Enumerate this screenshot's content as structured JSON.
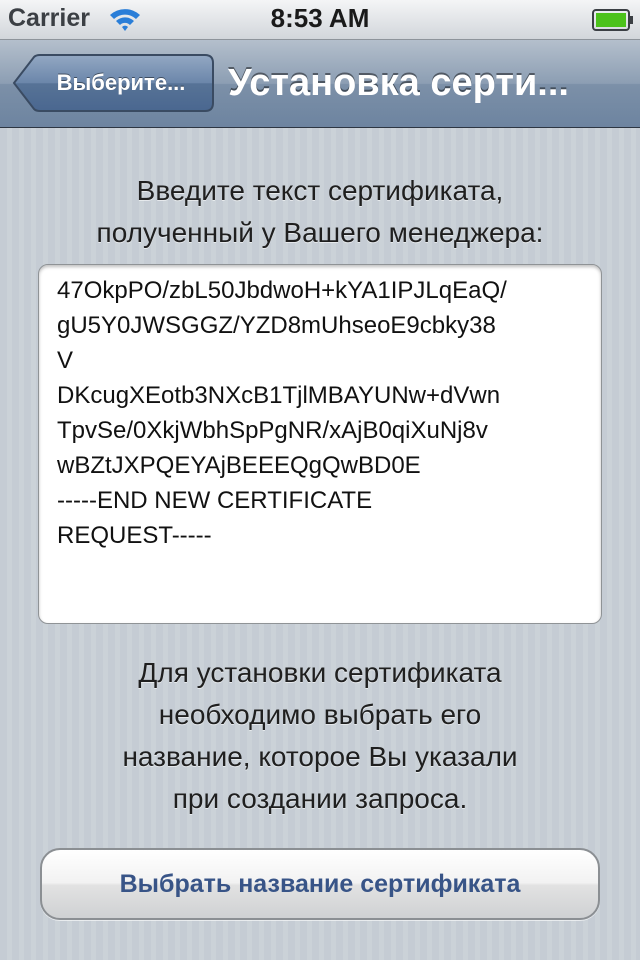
{
  "status_bar": {
    "carrier": "Carrier",
    "time": "8:53 AM",
    "wifi_icon": "wifi-icon",
    "battery_icon": "battery-full-icon",
    "battery_color": "#4cc21b"
  },
  "nav_bar": {
    "back_label": "Выберите...",
    "title": "Установка серти..."
  },
  "content": {
    "intro_lines": [
      "Введите текст сертификата,",
      "полученный у Вашего менеджера:"
    ],
    "certificate_lines": [
      "47OkpPO/zbL50JbdwoH+kYA1IPJLqEaQ/",
      "gU5Y0JWSGGZ/YZD8mUhseoE9cbky38",
      "V",
      "DKcugXEotb3NXcB1TjlMBAYUNw+dVwn",
      "TpvSe/0XkjWbhSpPgNR/xAjB0qiXuNj8v",
      "wBZtJXPQEYAjBEEEQgQwBD0E",
      "-----END NEW CERTIFICATE",
      "REQUEST-----"
    ],
    "note_lines": [
      "Для установки сертификата",
      "необходимо выбрать его",
      "название, которое Вы указали",
      "при создании запроса."
    ],
    "choose_button_label": "Выбрать название сертификата"
  },
  "colors": {
    "nav_bar": "#7c90a8",
    "background": "#c5ccd4",
    "button_text": "#385487"
  }
}
